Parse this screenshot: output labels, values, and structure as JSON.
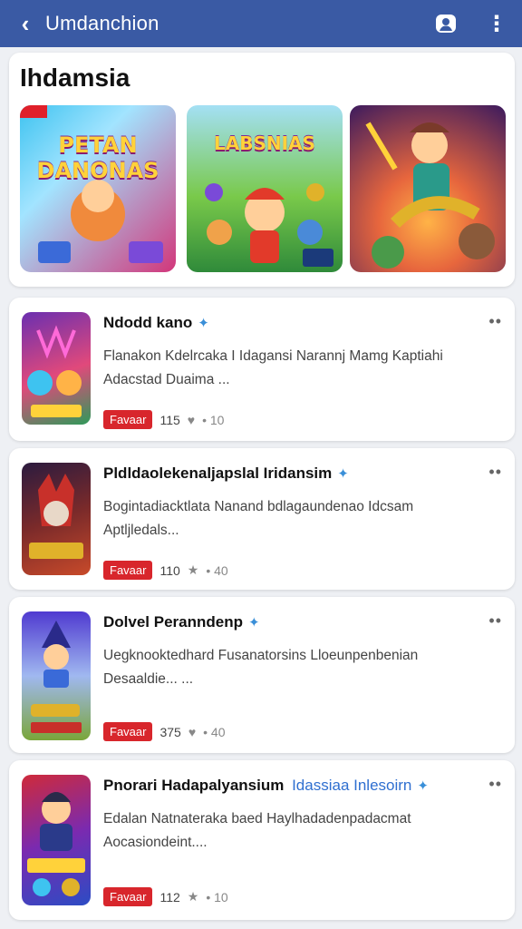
{
  "appbar": {
    "title": "Umdanchion",
    "back_glyph": "‹",
    "menu_glyph": "⋮"
  },
  "featured": {
    "heading": "Ihdamsia",
    "tiles": [
      {
        "label": "PETAN DANONAS",
        "colors": [
          "#3ec3f0",
          "#d2367a"
        ]
      },
      {
        "label": "LABSNIAS",
        "colors": [
          "#79c94a",
          "#2f8a3a"
        ]
      },
      {
        "label": "",
        "colors": [
          "#e7663d",
          "#3b1a5e"
        ]
      }
    ]
  },
  "games": [
    {
      "name": "Ndodd kano",
      "verified": "✦",
      "more": "••",
      "desc": "Flanakon Kdelrcaka I Idagansi Narannj Mamg Kaptiahi Adacstad Duaima ...",
      "button": "Favaar",
      "count": "115",
      "stat_icon": "♥",
      "stat": "• 10",
      "thumb_text": "COMUS",
      "colors": [
        "#6a2fb0",
        "#e1497b"
      ]
    },
    {
      "name": "Pldldaolekenaljapslal Iridansim",
      "verified": "✦",
      "more": "••",
      "desc": "Bogintadiacktlata Nanand bdlagaundenao Idcsam Aptljledals...",
      "button": "Favaar",
      "count": "110",
      "stat_icon": "★",
      "stat": "• 40",
      "thumb_text": "DUNDAS",
      "colors": [
        "#2b1b3f",
        "#c84a2a"
      ]
    },
    {
      "name": "Dolvel Peranndenp",
      "verified": "✦",
      "more": "••",
      "desc": "Uegknooktedhard Fusanatorsins Lloeunpenbenian Desaaldie... ...",
      "button": "Favaar",
      "count": "375",
      "stat_icon": "♥",
      "stat": "• 40",
      "thumb_text": "DUNDAS",
      "colors": [
        "#4f3ad0",
        "#7aa63a"
      ]
    },
    {
      "name": "Pnorari Hadapalyansium",
      "name_accent": "Idassiaa Inlesoirn",
      "verified": "✦",
      "more": "••",
      "desc": "Edalan Natnateraka baed Haylhadadenpadacmat Aocasiondeint....",
      "button": "Favaar",
      "count": "112",
      "stat_icon": "★",
      "stat": "• 10",
      "thumb_text": "OESEIS",
      "colors": [
        "#cf2a3a",
        "#2c4cc4"
      ]
    }
  ]
}
